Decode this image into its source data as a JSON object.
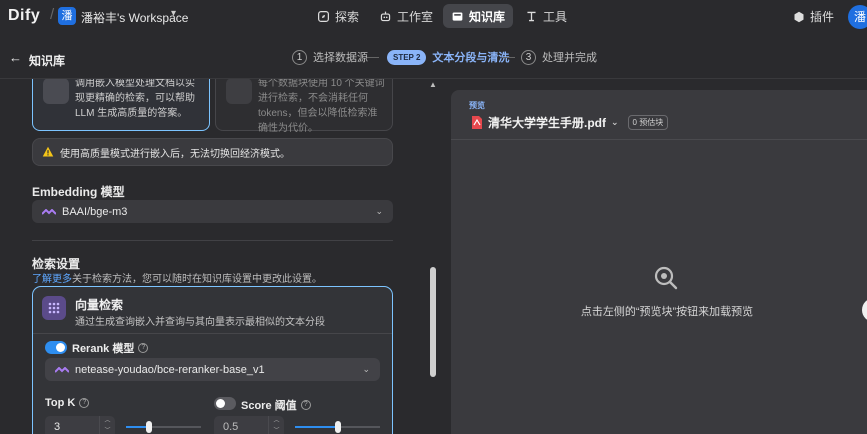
{
  "app": {
    "logo": "Dify",
    "workspace_avatar": "潘",
    "workspace_name": "潘裕丰's Workspace",
    "user_avatar": "潘"
  },
  "nav": [
    {
      "label": "探索",
      "icon": "compass-icon"
    },
    {
      "label": "工作室",
      "icon": "robot-icon"
    },
    {
      "label": "知识库",
      "icon": "book-icon",
      "active": true
    },
    {
      "label": "工具",
      "icon": "tools-icon"
    }
  ],
  "plugin_label": "插件",
  "subheader": {
    "title": "知识库",
    "steps": [
      {
        "num": "1",
        "label": "选择数据源"
      },
      {
        "num": "STEP 2",
        "label": "文本分段与清洗",
        "current": true
      },
      {
        "num": "3",
        "label": "处理并完成"
      }
    ]
  },
  "index_cards": {
    "high_quality_text": "调用嵌入模型处理文档以实现更精确的检索，可以帮助 LLM 生成高质量的答案。",
    "economy_text": "每个数据块使用 10 个关键词进行检索，不会消耗任何 tokens，但会以降低检索准确性为代价。"
  },
  "warning_text": "使用高质量模式进行嵌入后，无法切换回经济模式。",
  "embedding": {
    "label": "Embedding 模型",
    "value": "BAAI/bge-m3"
  },
  "retrieval": {
    "title": "检索设置",
    "link": "了解更多",
    "desc": "关于检索方法，您可以随时在知识库设置中更改此设置。",
    "vector": {
      "title": "向量检索",
      "subtitle": "通过生成查询嵌入并查询与其向量表示最相似的文本分段"
    },
    "rerank": {
      "label": "Rerank 模型",
      "enabled": true,
      "value": "netease-youdao/bce-reranker-base_v1"
    },
    "topk": {
      "label": "Top K",
      "value": "3",
      "fraction": 0.3
    },
    "score": {
      "label": "Score 阈值",
      "enabled": false,
      "value": "0.5",
      "fraction": 0.5
    }
  },
  "preview": {
    "label": "预览",
    "file_name": "清华大学学生手册.pdf",
    "chunks": "0 预估块",
    "empty_text": "点击左侧的“预览块”按钮来加载预览"
  },
  "colors": {
    "accent": "#2e8ef0",
    "selected_border": "#7cc4ff",
    "link": "#5fa8ff"
  }
}
